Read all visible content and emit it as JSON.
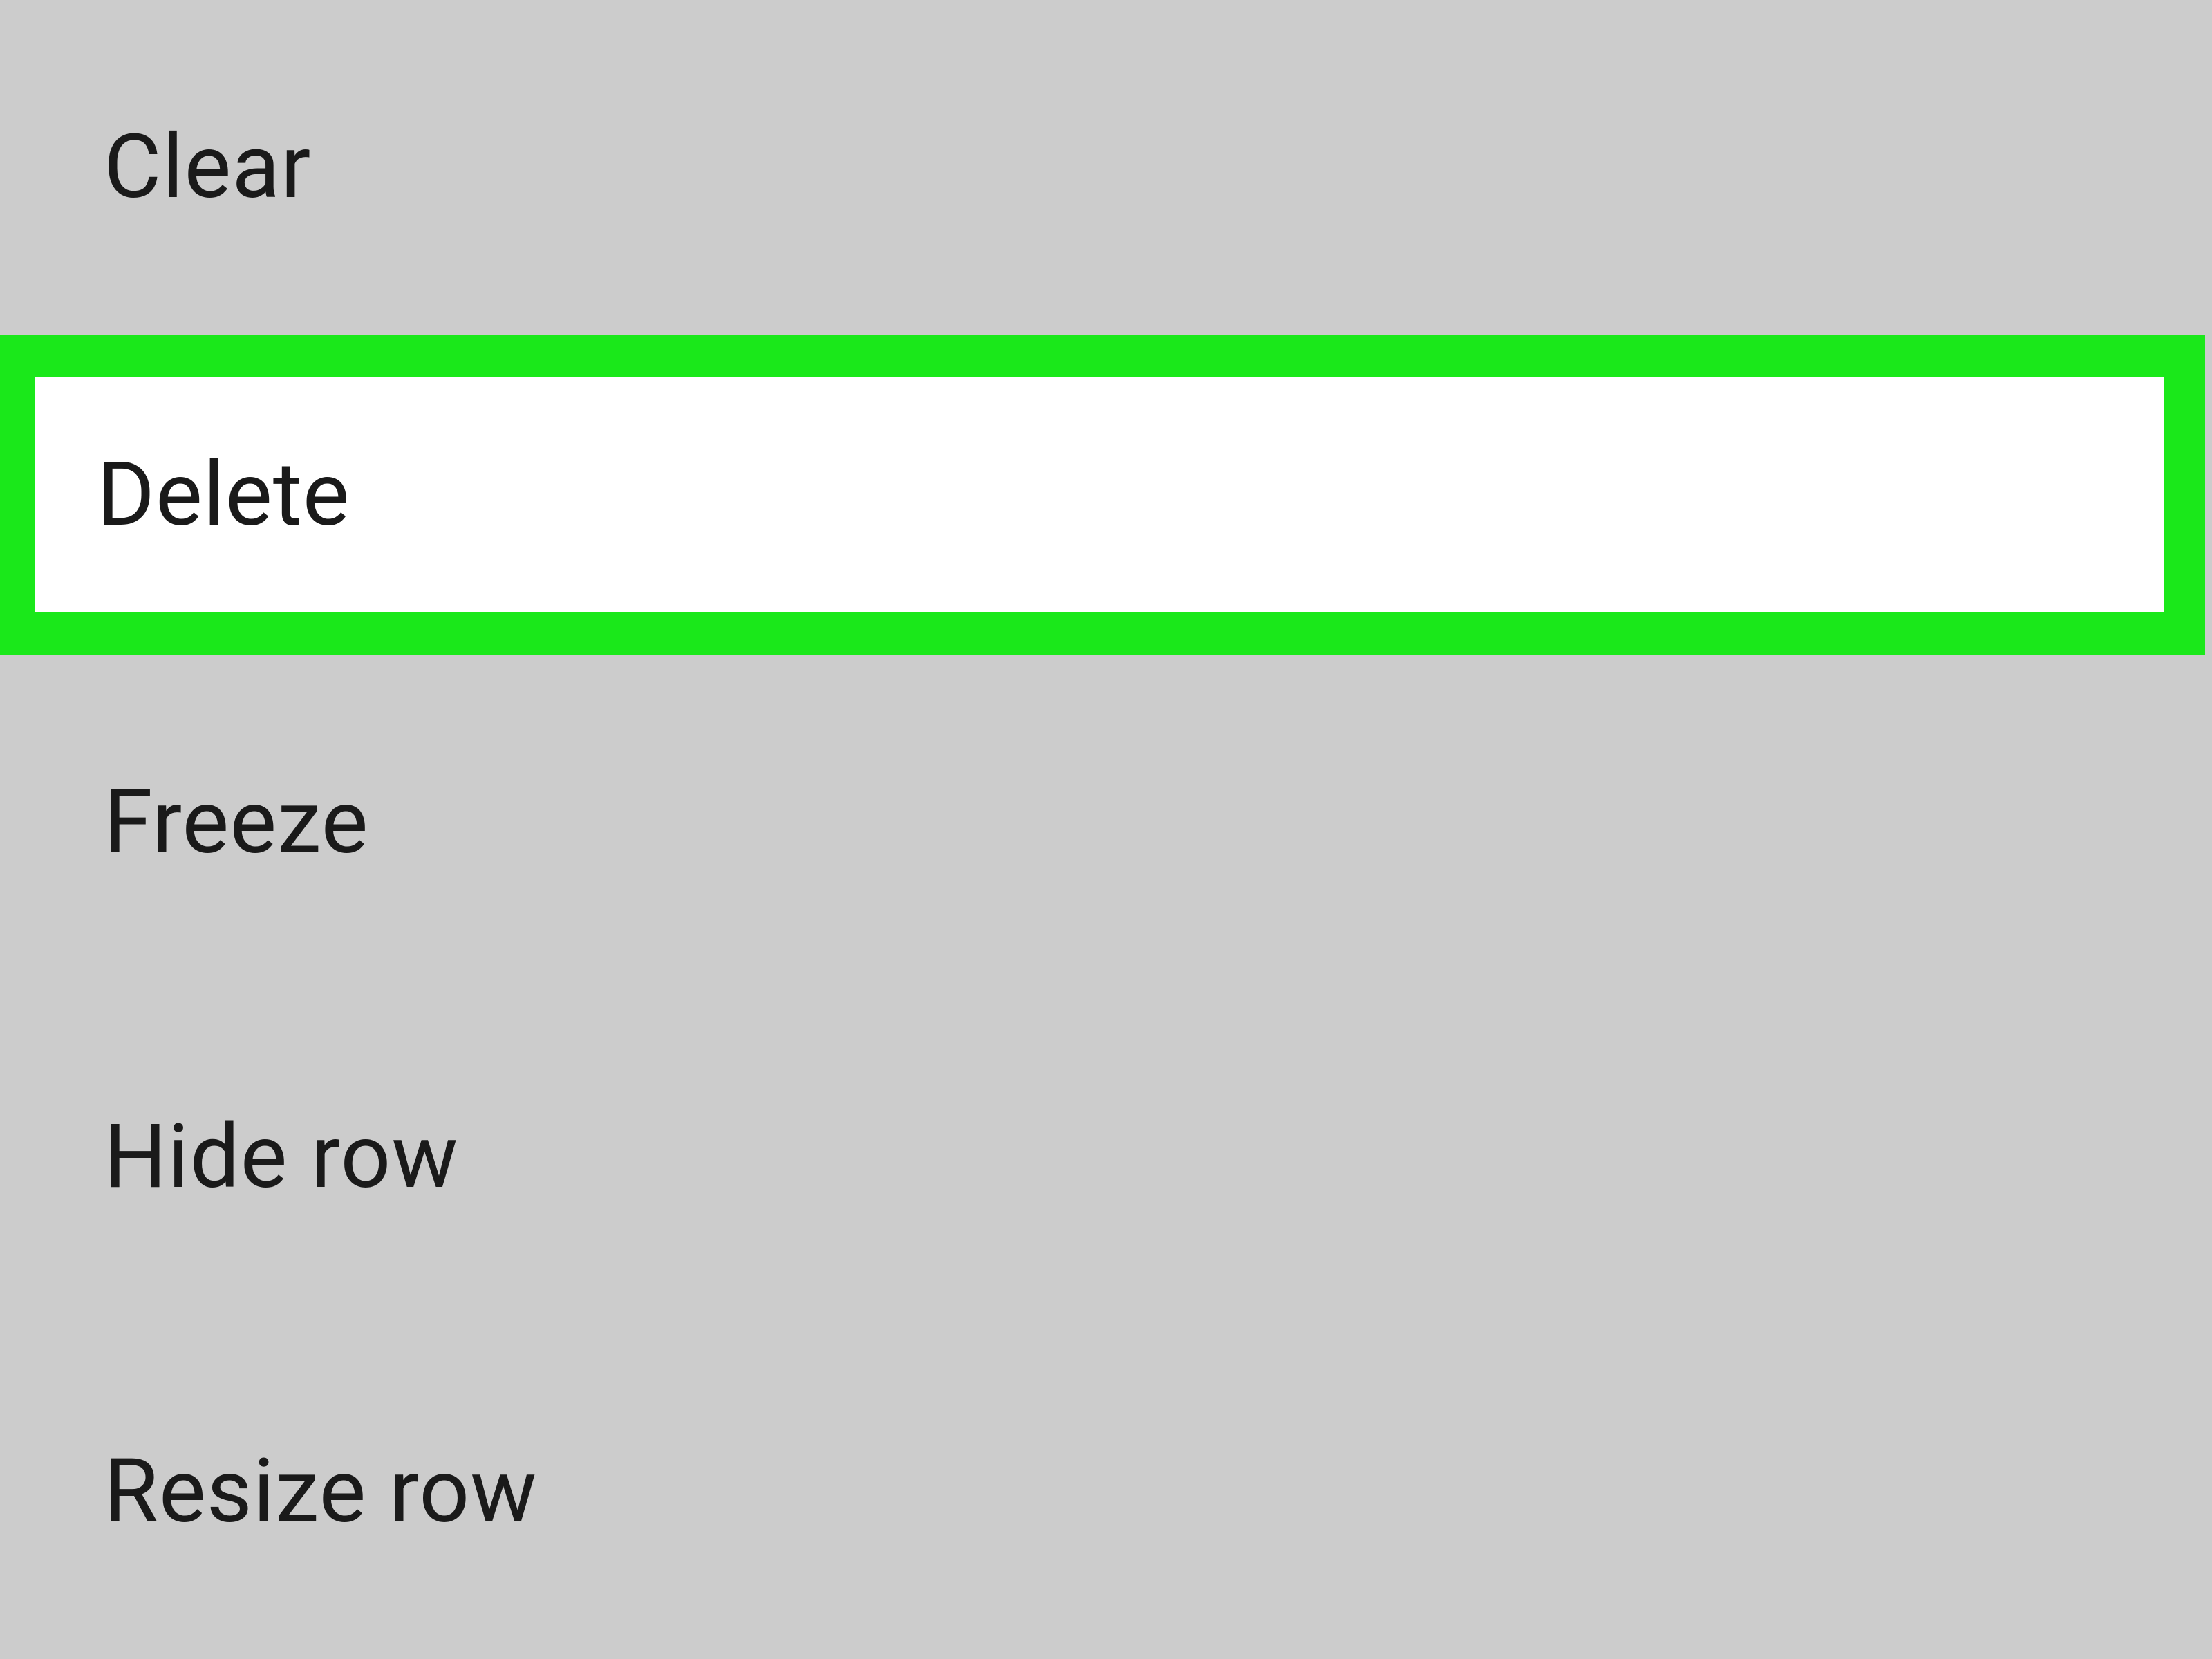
{
  "menu": {
    "items": [
      {
        "label": "Clear",
        "highlighted": false
      },
      {
        "label": "Delete",
        "highlighted": true
      },
      {
        "label": "Freeze",
        "highlighted": false
      },
      {
        "label": "Hide row",
        "highlighted": false
      },
      {
        "label": "Resize row",
        "highlighted": false
      }
    ]
  },
  "highlight_color": "#1ae81a",
  "background_color": "#cccccc"
}
